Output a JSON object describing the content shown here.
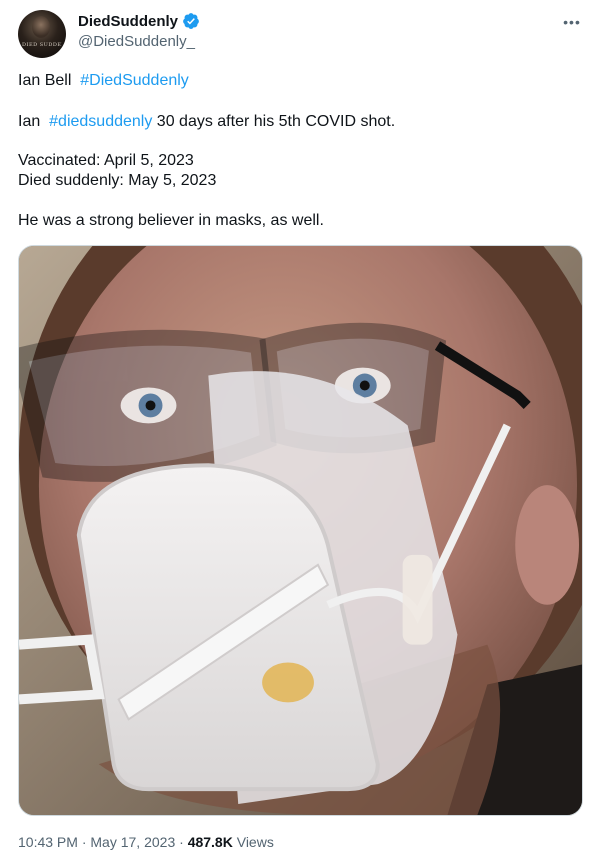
{
  "author": {
    "display_name": "DiedSuddenly",
    "handle": "@DiedSuddenly_",
    "avatar_text": "DIED SUDDENLY",
    "verified": true
  },
  "tweet": {
    "line1_text": "Ian Bell",
    "line1_hashtag": "#DiedSuddenly",
    "line2_prefix": "Ian",
    "line2_hashtag": "#diedsuddenly",
    "line2_suffix": "30 days after his 5th COVID shot.",
    "vaccinated": "Vaccinated: April 5, 2023",
    "died": "Died suddenly: May 5, 2023",
    "masks": "He was a strong believer in masks, as well."
  },
  "footer": {
    "time": "10:43 PM",
    "separator": "·",
    "date": "May 17, 2023",
    "separator2": "·",
    "views_count": "487.8K",
    "views_label": "Views"
  },
  "colors": {
    "accent": "#1d9bf0",
    "text": "#0f1419",
    "muted": "#536471"
  },
  "icons": {
    "verified": "verified-badge-icon",
    "more": "more-options-icon"
  }
}
